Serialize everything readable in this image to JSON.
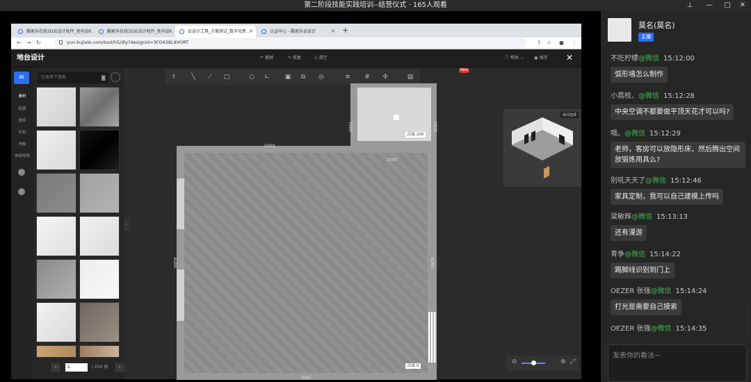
{
  "window": {
    "title": "第二阶段技能实践培训--结营仪式 · 165人观看",
    "controls": [
      "pin-icon",
      "minimize-icon",
      "maximize-icon",
      "close-icon"
    ]
  },
  "browser": {
    "tabs": [
      {
        "label": "酷家乐在线3D云设计软件_室内设..."
      },
      {
        "label": "酷家乐在线3D云设计软件_室内设..."
      },
      {
        "label": "云设计工具_方案测试_数字化新..."
      },
      {
        "label": "认证中心 - 酷家乐云设计"
      }
    ],
    "active_tab": 2,
    "url": "yun.kujiale.com/tool/h5/diy?designid=3FO438L9VORT"
  },
  "app": {
    "title": "地台设计",
    "header_actions": [
      {
        "icon": "undo-icon",
        "label": "撤销"
      },
      {
        "icon": "redo-icon",
        "label": "恢复"
      },
      {
        "icon": "clear-icon",
        "label": "清空"
      }
    ],
    "help_label": "帮助",
    "save_label": "保存",
    "categories": [
      "素材",
      "贴图",
      "瓷砖",
      "石材",
      "地板",
      "体组地面"
    ],
    "search_placeholder": "在类目下搜索",
    "pager": {
      "current": "1",
      "total": "/ 250 页"
    },
    "new_badge": "New"
  },
  "floorplan": {
    "dimensions": {
      "top_main": "5000",
      "bottom": "7000",
      "left": "6200",
      "right": "6200",
      "room_small_left": "1500",
      "room_small_right": "1500",
      "room_small_bottom": "2000"
    },
    "tags": {
      "small_room": "凸出 200",
      "main_room": "凸出 0"
    }
  },
  "preview": {
    "label": "房间选择"
  },
  "chat": {
    "host": {
      "name": "莫名(莫名)",
      "role": "主播"
    },
    "messages": [
      {
        "user": "不吃柠檬",
        "source": "@微信",
        "time": "15:12:00",
        "text": "弧形墙怎么制作"
      },
      {
        "user": "小荔枝、",
        "source": "@微信",
        "time": "15:12:28",
        "text": "中央空调不都要做平顶天花才可以吗?"
      },
      {
        "user": "哦。",
        "source": "@微信",
        "time": "15:12:29",
        "text": "老师，客房可以放隐形床，然后腾出空间放锻炼用具么?"
      },
      {
        "user": "别吼天天了",
        "source": "@微信",
        "time": "15:12:46",
        "text": "家具定制，我可以自己建模上传吗"
      },
      {
        "user": "梁敏辉",
        "source": "@微信",
        "time": "15:13:13",
        "text": "还有漫游"
      },
      {
        "user": "青争",
        "source": "@微信",
        "time": "15:14:22",
        "text": "踢脚线识别到门上"
      },
      {
        "user": "OEZER  张强",
        "source": "@微信",
        "time": "15:14:24",
        "text": "打光是需要自己摸索"
      },
      {
        "user": "OEZER  张强",
        "source": "@微信",
        "time": "15:14:35",
        "text": ""
      }
    ],
    "input_placeholder": "发表你的看法~"
  }
}
